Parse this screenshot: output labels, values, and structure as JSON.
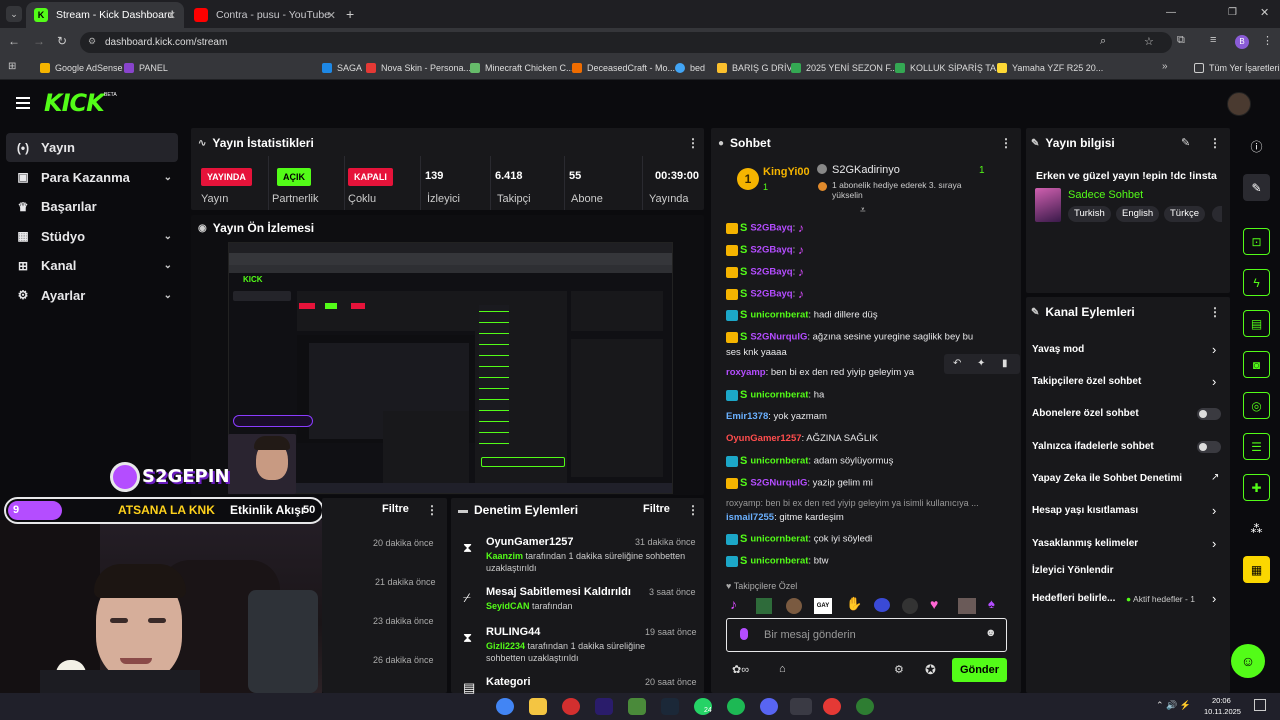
{
  "browser": {
    "tabs": [
      {
        "title": "Stream - Kick Dashboard",
        "active": true
      },
      {
        "title": "Contra - pusu - YouTube",
        "active": false
      }
    ],
    "url": "dashboard.kick.com/stream",
    "bookmarks": [
      "Google AdSense",
      "PANEL",
      "SAGA",
      "Nova Skin - Persona...",
      "Minecraft Chicken C...",
      "DeceasedCraft - Mo...",
      "bed",
      "BARIŞ G DRİVE",
      "2025 YENİ SEZON F...",
      "KOLLUK SİPARİŞ TA...",
      "Yamaha YZF R25 20..."
    ],
    "bookmarks_all": "Tüm Yer İşaretleri",
    "profile_initial": "B"
  },
  "kick": {
    "logo": "KICK",
    "logo_sup": "BETA",
    "nav": [
      {
        "label": "Yayın",
        "icon": "broadcast-icon",
        "active": true,
        "expand": false
      },
      {
        "label": "Para Kazanma",
        "icon": "wallet-icon",
        "active": false,
        "expand": true
      },
      {
        "label": "Başarılar",
        "icon": "trophy-icon",
        "active": false,
        "expand": false
      },
      {
        "label": "Stüdyo",
        "icon": "studio-icon",
        "active": false,
        "expand": true
      },
      {
        "label": "Kanal",
        "icon": "channel-icon",
        "active": false,
        "expand": true
      },
      {
        "label": "Ayarlar",
        "icon": "gear-icon",
        "active": false,
        "expand": true
      }
    ],
    "stats": {
      "title": "Yayın İstatistikleri",
      "cells": [
        {
          "badge": "YAYINDA",
          "label": "Yayın"
        },
        {
          "badge": "AÇIK",
          "label": "Partnerlik"
        },
        {
          "badge": "KAPALI",
          "label": "Çoklu"
        },
        {
          "value": "139",
          "label": "İzleyici"
        },
        {
          "value": "6.418",
          "label": "Takipçi"
        },
        {
          "value": "55",
          "label": "Abone"
        },
        {
          "value": "00:39:00",
          "label": "Yayında"
        }
      ]
    },
    "preview": {
      "title": "Yayın Ön İzlemesi"
    },
    "overlay": {
      "logo_text": "S2GEPIN",
      "goal_count": "9",
      "goal_text": "ATSANA LA KNK",
      "goal_target": "50"
    },
    "activity": {
      "title": "Etkinlik Akışı",
      "filter": "Filtre",
      "times": [
        "20 dakika önce",
        "21 dakika önce",
        "23 dakika önce",
        "26 dakika önce"
      ]
    },
    "moderation": {
      "title": "Denetim Eylemleri",
      "filter": "Filtre",
      "items": [
        {
          "name": "OyunGamer1257",
          "time": "31 dakika önce",
          "actor": "Kaanzim",
          "desc": " tarafından 1 dakika süreliğine sohbetten",
          "desc2": "uzaklaştırıldı",
          "icon": "hourglass-icon"
        },
        {
          "name": "Mesaj Sabitlemesi Kaldırıldı",
          "time": "3 saat önce",
          "actor": "SeyidCAN",
          "desc": " tarafından",
          "desc2": "",
          "icon": "unpin-icon"
        },
        {
          "name": "RULING44",
          "time": "19 saat önce",
          "actor": "Gizli2234",
          "desc": " tarafından 1 dakika süreliğine",
          "desc2": "sohbetten uzaklaştırıldı",
          "icon": "hourglass-icon"
        },
        {
          "name": "Kategori",
          "time": "20 saat önce",
          "actor": "",
          "desc": "",
          "desc2": "",
          "icon": "category-icon"
        }
      ]
    },
    "chat": {
      "title": "Sohbet",
      "pinned": [
        {
          "name": "KingYi00",
          "count": "1"
        },
        {
          "name": "S2GKadirinyo",
          "count": "1",
          "text": "1 abonelik hediye ederek 3. sıraya yükselin"
        }
      ],
      "messages": [
        {
          "user": "S2GBayq",
          "color": "#b44dff",
          "text": "",
          "emote": true,
          "crown": true
        },
        {
          "user": "S2GBayq",
          "color": "#b44dff",
          "text": "",
          "emote": true,
          "crown": true
        },
        {
          "user": "S2GBayq",
          "color": "#b44dff",
          "text": "",
          "emote": true,
          "crown": true
        },
        {
          "user": "S2GBayq",
          "color": "#b44dff",
          "text": "",
          "emote": true,
          "crown": true
        },
        {
          "user": "unicornberat",
          "color": "#53fc18",
          "text": "hadi dillere düş",
          "crown": false
        },
        {
          "user": "S2GNurqulG",
          "color": "#b44dff",
          "text": "ağzına sesine yuregine saglikk bey bu",
          "text2": "ses knk yaaaa",
          "crown": true
        },
        {
          "user": "roxyamp",
          "color": "#b44dff",
          "text": "ben bi ex den red yiyip geleyim ya",
          "plain": true
        },
        {
          "user": "unicornberat",
          "color": "#53fc18",
          "text": "ha",
          "crown": false
        },
        {
          "user": "Emir1378",
          "color": "#6ab0ff",
          "text": "yok yazmam",
          "plain": true
        },
        {
          "user": "OyunGamer1257",
          "color": "#ff4d4d",
          "text": "AĞZINA SAĞLIK",
          "plain": true
        },
        {
          "user": "unicornberat",
          "color": "#53fc18",
          "text": "adam söylüyormuş",
          "crown": false
        },
        {
          "user": "S2GNurqulG",
          "color": "#b44dff",
          "text": "yazip gelim mi",
          "crown": true
        },
        {
          "reply": "roxyamp: ben bi ex den red yiyip geleyim ya isimli kullanıcıya ...",
          "user": "ismail7255",
          "color": "#6ab0ff",
          "text": "gitme kardeşim",
          "plain": true
        },
        {
          "user": "unicornberat",
          "color": "#53fc18",
          "text": "çok iyi söyledi",
          "crown": false
        },
        {
          "user": "unicornberat",
          "color": "#53fc18",
          "text": "btw",
          "crown": false
        }
      ],
      "followers_only": "Takipçilere Özel",
      "input_placeholder": "Bir mesaj gönderin",
      "send": "Gönder"
    },
    "info": {
      "title": "Yayın bilgisi",
      "stream_title": "Erken ve güzel yayın !epin !dc !insta",
      "category": "Sadece Sohbet",
      "tags": [
        "Turkish",
        "English",
        "Türkçe"
      ]
    },
    "actions": {
      "title": "Kanal Eylemleri",
      "items": [
        {
          "label": "Yavaş mod",
          "kind": "chevron"
        },
        {
          "label": "Takipçilere özel sohbet",
          "kind": "chevron"
        },
        {
          "label": "Abonelere özel sohbet",
          "kind": "toggle"
        },
        {
          "label": "Yalnızca ifadelerle sohbet",
          "kind": "toggle"
        },
        {
          "label": "Yapay Zeka ile Sohbet Denetimi",
          "kind": "external"
        },
        {
          "label": "Hesap yaşı kısıtlaması",
          "kind": "chevron"
        },
        {
          "label": "Yasaklanmış kelimeler",
          "kind": "chevron"
        },
        {
          "label": "İzleyici Yönlendir",
          "kind": "none"
        },
        {
          "label": "Hedefleri belirle...",
          "kind": "chevron",
          "extra": "Aktif hedefler - 1"
        }
      ]
    }
  },
  "taskbar": {
    "time": "20:06",
    "date": "10.11.2025",
    "badge": "24"
  },
  "colors": {
    "accent": "#53fc18",
    "live": "#e6133a",
    "panel": "#18181b",
    "bg": "#0b0b0e"
  }
}
